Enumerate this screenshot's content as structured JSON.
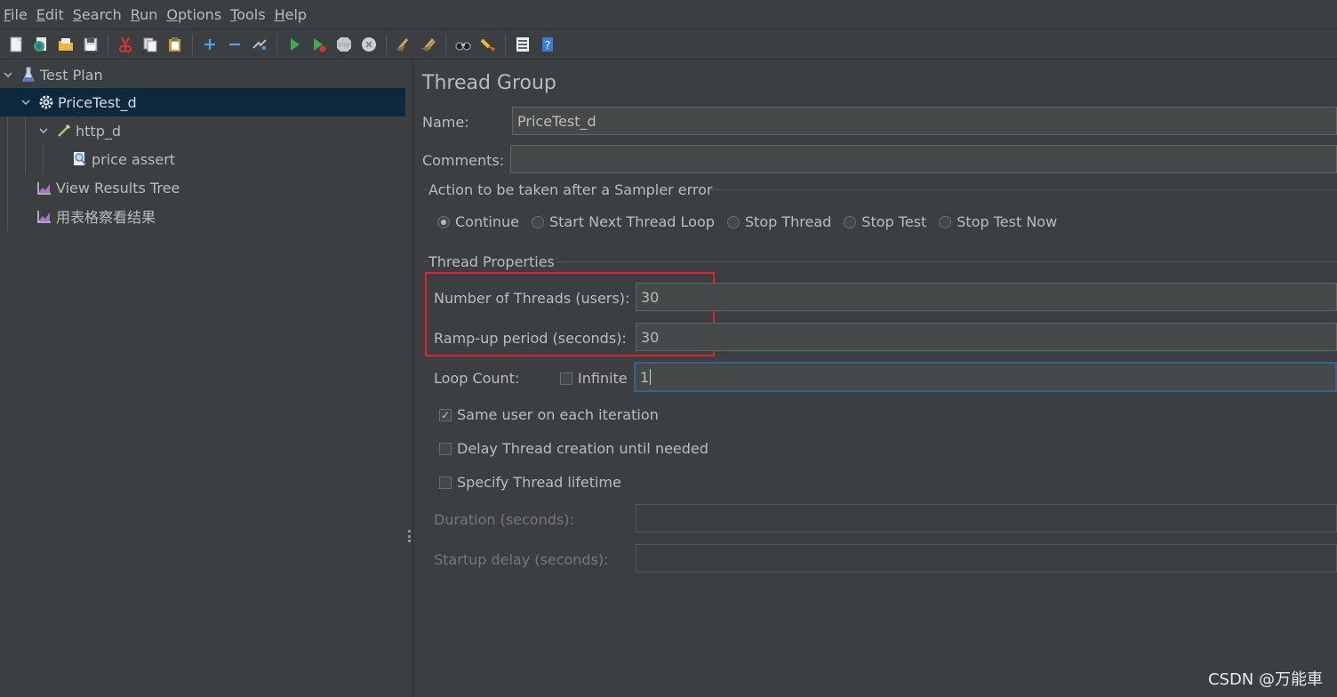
{
  "menu": {
    "items": [
      {
        "key": "F",
        "rest": "ile"
      },
      {
        "key": "E",
        "rest": "dit"
      },
      {
        "key": "S",
        "rest": "earch"
      },
      {
        "key": "R",
        "rest": "un"
      },
      {
        "key": "O",
        "rest": "ptions"
      },
      {
        "key": "T",
        "rest": "ools"
      },
      {
        "key": "H",
        "rest": "elp"
      }
    ]
  },
  "toolbar": {
    "icons": [
      "new-icon",
      "templates-icon",
      "open-icon",
      "save-icon",
      "cut-icon",
      "copy-icon",
      "paste-icon",
      "expand-icon",
      "collapse-icon",
      "toggle-icon",
      "start-icon",
      "start-no-pause-icon",
      "stop-icon",
      "shutdown-icon",
      "clear-icon",
      "clear-all-icon",
      "search-icon",
      "reset-search-icon",
      "function-helper-icon",
      "help-icon"
    ]
  },
  "tree": {
    "items": [
      {
        "label": "Test Plan",
        "icon": "test-plan-icon"
      },
      {
        "label": "PriceTest_d",
        "icon": "gear-icon"
      },
      {
        "label": "http_d",
        "icon": "pipette-icon"
      },
      {
        "label": "price assert",
        "icon": "magnifier-icon"
      },
      {
        "label": "View Results Tree",
        "icon": "listener-icon"
      },
      {
        "label": "用表格察看结果",
        "icon": "listener-icon"
      }
    ]
  },
  "panel": {
    "title": "Thread Group",
    "name_label": "Name:",
    "name_value": "PriceTest_d",
    "comments_label": "Comments:",
    "comments_value": "",
    "error_group_label": "Action to be taken after a Sampler error",
    "error_options": [
      "Continue",
      "Start Next Thread Loop",
      "Stop Thread",
      "Stop Test",
      "Stop Test Now"
    ],
    "error_selected": "Continue",
    "props_group_label": "Thread Properties",
    "threads_label": "Number of Threads (users):",
    "threads_value": "30",
    "rampup_label": "Ramp-up period (seconds):",
    "rampup_value": "30",
    "loop_label": "Loop Count:",
    "infinite_label": "Infinite",
    "infinite_checked": false,
    "loop_value": "1",
    "same_user_label": "Same user on each iteration",
    "same_user_checked": true,
    "delay_label": "Delay Thread creation until needed",
    "delay_checked": false,
    "lifetime_label": "Specify Thread lifetime",
    "lifetime_checked": false,
    "duration_label": "Duration (seconds):",
    "startup_label": "Startup delay (seconds):"
  },
  "watermark": "CSDN @万能車",
  "colors": {
    "background": "#3c3f41",
    "selection": "#0d293e",
    "highlight_box": "#e0242e",
    "focus_border": "#3d6185"
  }
}
